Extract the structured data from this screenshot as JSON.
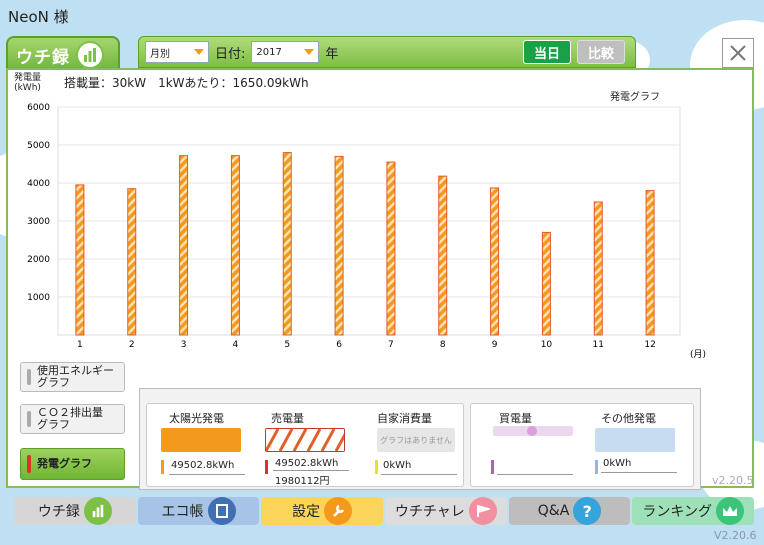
{
  "user": {
    "name": "NeoN 様"
  },
  "tab": {
    "label": "ウチ録"
  },
  "toolbar": {
    "period_select": "月別",
    "date_label": "日付:",
    "year_select": "2017",
    "year_unit": "年",
    "today_button": "当日",
    "compare_button": "比較"
  },
  "info": {
    "capacity": "搭載量：30kW　1kWあたり：1650.09kWh",
    "y_unit_line1": "発電量",
    "y_unit_line2": "(kWh)",
    "chart_title": "発電グラフ",
    "x_unit": "(月)"
  },
  "chart_data": {
    "type": "bar",
    "title": "発電グラフ",
    "xlabel": "(月)",
    "ylabel": "発電量 (kWh)",
    "categories": [
      "1",
      "2",
      "3",
      "4",
      "5",
      "6",
      "7",
      "8",
      "9",
      "10",
      "11",
      "12"
    ],
    "values": [
      3950,
      3850,
      4720,
      4720,
      4800,
      4700,
      4550,
      4180,
      3870,
      2700,
      3500,
      3800
    ],
    "ylim": [
      0,
      6000
    ],
    "yticks": [
      "1000",
      "2000",
      "3000",
      "4000",
      "5000",
      "6000"
    ],
    "grid": true,
    "bar_color": "#f39a1c",
    "bar_stripe_color": "#e05a2a"
  },
  "side_buttons": [
    {
      "label1": "使用エネルギー",
      "label2": "グラフ"
    },
    {
      "label1": "ＣＯ２排出量",
      "label2": "グラフ"
    },
    {
      "label1": "発電グラフ",
      "label2": ""
    }
  ],
  "legend": {
    "solar": {
      "title": "太陽光発電",
      "value": "49502.8kWh"
    },
    "sold": {
      "title": "売電量",
      "value": "49502.8kWh",
      "yen": "1980112円"
    },
    "self": {
      "title": "自家消費量",
      "swatch_text": "グラフはありません",
      "value": "0kWh"
    },
    "bought": {
      "title": "買電量",
      "value": ""
    },
    "other": {
      "title": "その他発電",
      "value": "0kWh"
    }
  },
  "nav": [
    {
      "label": "ウチ録",
      "icon": "bar-chart-icon"
    },
    {
      "label": "エコ帳",
      "icon": "notebook-icon"
    },
    {
      "label": "設定",
      "icon": "wrench-icon"
    },
    {
      "label": "ウチチャレ",
      "icon": "flag-icon"
    },
    {
      "label": "Q&A",
      "icon": "question-icon"
    },
    {
      "label": "ランキング",
      "icon": "crown-icon"
    }
  ],
  "versions": {
    "inner": "v2.20.5",
    "outer": "V2.20.6"
  }
}
